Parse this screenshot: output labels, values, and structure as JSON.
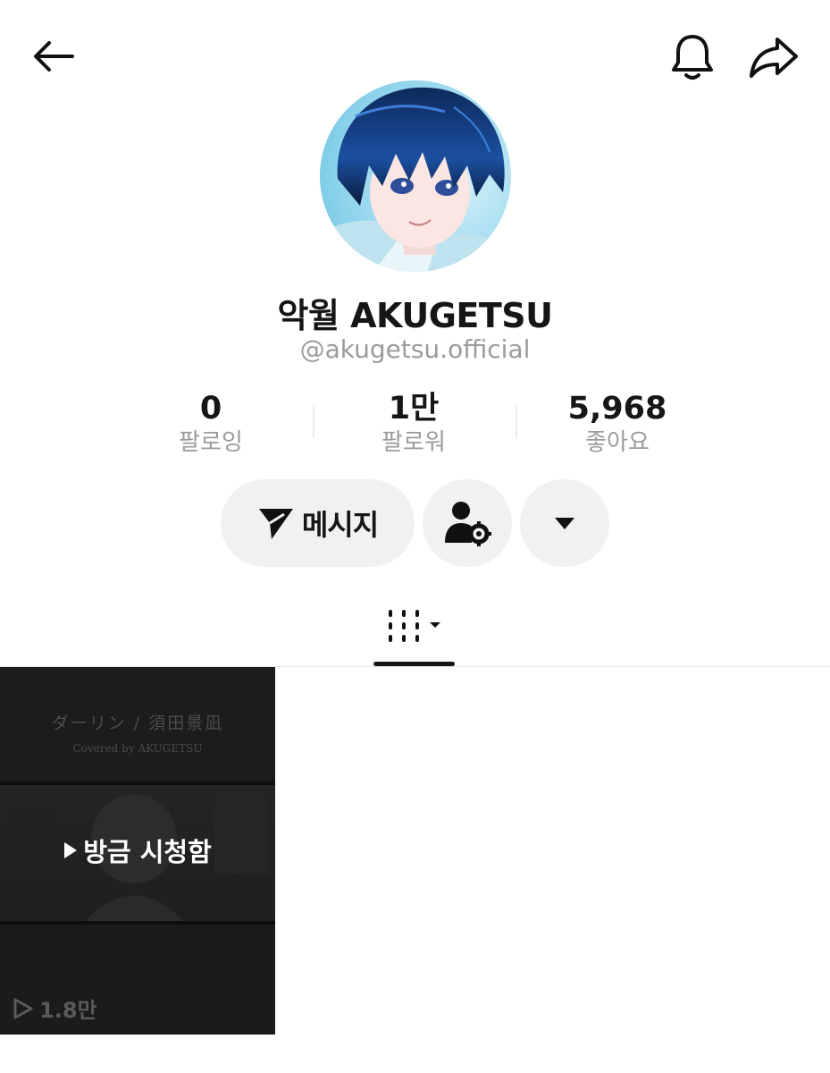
{
  "profile": {
    "display_name": "악월 AKUGETSU",
    "handle": "@akugetsu.official"
  },
  "stats": {
    "following": {
      "value": "0",
      "label": "팔로잉"
    },
    "followers": {
      "value": "1만",
      "label": "팔로워"
    },
    "likes": {
      "value": "5,968",
      "label": "좋아요"
    }
  },
  "actions": {
    "message_label": "메시지"
  },
  "videos": [
    {
      "title_text": "ダーリン / 須田景凪",
      "subtitle_text": "Covered by AKUGETSU",
      "watched_label": "방금 시청함",
      "views": "1.8만"
    }
  ],
  "icons": {
    "back": "back-arrow-icon",
    "bell": "bell-icon",
    "share": "share-icon",
    "message": "send-icon",
    "friend": "person-settings-icon",
    "more": "caret-down-icon",
    "grid": "grid-icon"
  },
  "colors": {
    "text_primary": "#161616",
    "text_secondary": "#9b9b9b",
    "button_bg": "#f1f1f1"
  }
}
